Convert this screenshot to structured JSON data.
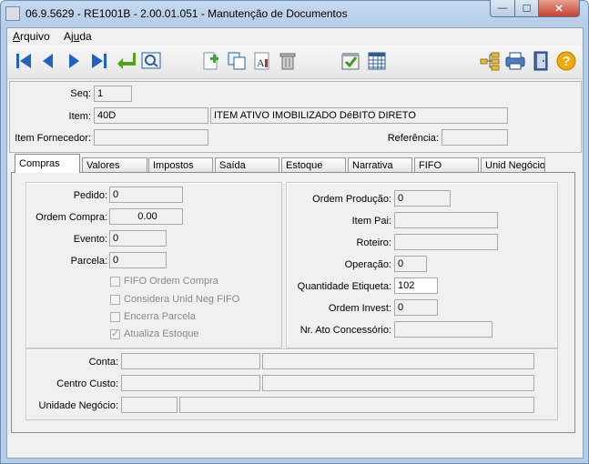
{
  "window": {
    "title": "06.9.5629 - RE1001B - 2.00.01.051 - Manutenção de Documentos",
    "min_glyph": "—",
    "max_glyph": "☐",
    "close_glyph": "✕"
  },
  "menu": {
    "arquivo": "Arquivo",
    "ajuda": "Ajuda"
  },
  "toolbar": {
    "icons": [
      "first-icon",
      "prev-icon",
      "next-icon",
      "last-icon",
      "goto-icon",
      "search-icon",
      "new-icon",
      "copy-icon",
      "edit-icon",
      "delete-icon",
      "confirm-icon",
      "calendar-icon",
      "tree-icon",
      "print-icon",
      "exit-icon",
      "help-icon"
    ]
  },
  "header": {
    "seq_label": "Seq:",
    "seq_value": "1",
    "item_label": "Item:",
    "item_code": "40D",
    "item_desc": "ITEM ATIVO IMOBILIZADO DéBITO DIRETO",
    "item_fornecedor_label": "Item Fornecedor:",
    "item_fornecedor_value": "",
    "referencia_label": "Referência:",
    "referencia_value": ""
  },
  "tabs": [
    "Compras",
    "Valores",
    "Impostos",
    "Saída",
    "Estoque",
    "Narrativa",
    "FIFO",
    "Unid Negócio"
  ],
  "compras": {
    "pedido_label": "Pedido:",
    "pedido_value": "0",
    "ordem_compra_label": "Ordem Compra:",
    "ordem_compra_value": "0.00",
    "evento_label": "Evento:",
    "evento_value": "0",
    "parcela_label": "Parcela:",
    "parcela_value": "0",
    "checkboxes": [
      {
        "label": "FIFO Ordem Compra",
        "checked": false
      },
      {
        "label": "Considera Unid Neg FIFO",
        "checked": false
      },
      {
        "label": "Encerra Parcela",
        "checked": false
      },
      {
        "label": "Atualiza Estoque",
        "checked": true
      }
    ],
    "ordem_producao_label": "Ordem Produção:",
    "ordem_producao_value": "0",
    "item_pai_label": "Item Pai:",
    "item_pai_value": "",
    "roteiro_label": "Roteiro:",
    "roteiro_value": "",
    "operacao_label": "Operação:",
    "operacao_value": "0",
    "qtd_etiqueta_label": "Quantidade Etiqueta:",
    "qtd_etiqueta_value": "102",
    "ordem_invest_label": "Ordem Invest:",
    "ordem_invest_value": "0",
    "nr_ato_label": "Nr. Ato Concessório:",
    "nr_ato_value": "",
    "conta_label": "Conta:",
    "centro_custo_label": "Centro Custo:",
    "unidade_negocio_label": "Unidade Negócio:"
  }
}
